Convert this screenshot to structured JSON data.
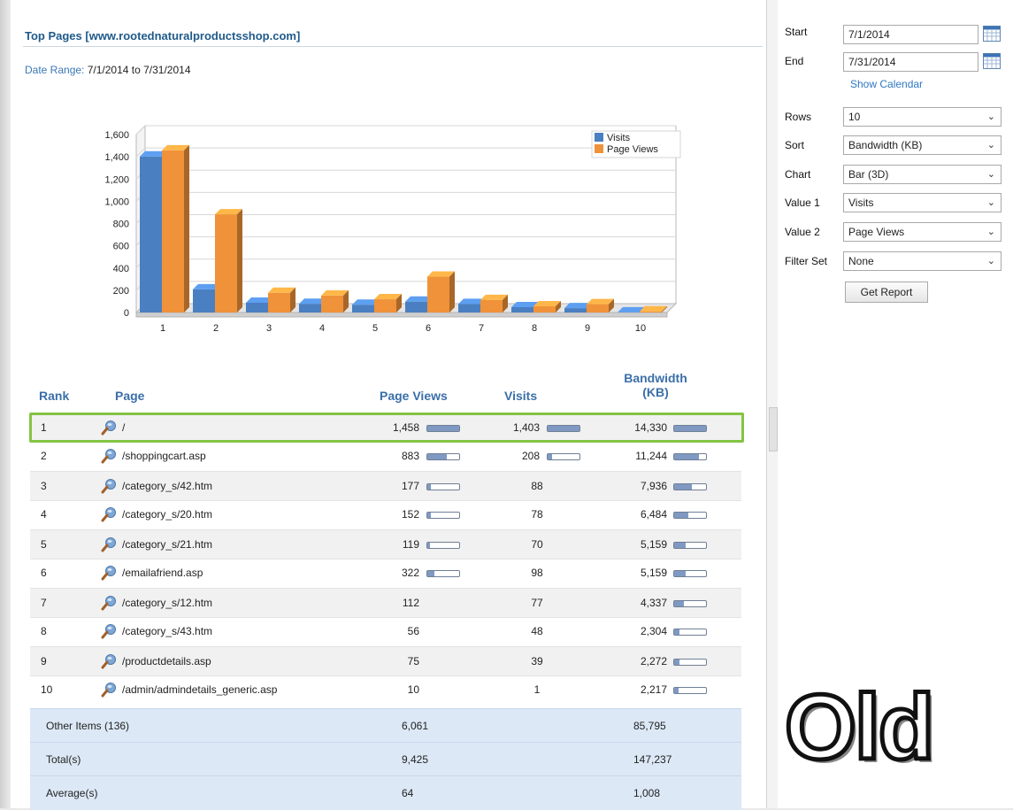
{
  "report": {
    "title": "Top Pages [www.rootednaturalproductsshop.com]",
    "date_range_label": "Date Range:",
    "date_range_value": "7/1/2014 to 7/31/2014"
  },
  "chart_data": {
    "type": "bar",
    "categories": [
      "1",
      "2",
      "3",
      "4",
      "5",
      "6",
      "7",
      "8",
      "9",
      "10"
    ],
    "series": [
      {
        "name": "Visits",
        "color": "#4a7fc1",
        "values": [
          1403,
          208,
          88,
          78,
          70,
          98,
          77,
          48,
          39,
          1
        ]
      },
      {
        "name": "Page Views",
        "color": "#f0923a",
        "values": [
          1458,
          883,
          177,
          152,
          119,
          322,
          112,
          56,
          75,
          10
        ]
      }
    ],
    "yticks": [
      "1,600",
      "1,400",
      "1,200",
      "1,000",
      "800",
      "600",
      "400",
      "200",
      "0"
    ],
    "ylim": [
      0,
      1600
    ],
    "legend": "top-right",
    "style": "3d"
  },
  "table": {
    "headers": {
      "rank": "Rank",
      "page": "Page",
      "page_views": "Page Views",
      "visits": "Visits",
      "bandwidth_1": "Bandwidth",
      "bandwidth_2": "(KB)"
    },
    "rows": [
      {
        "rank": "1",
        "page": "/",
        "pv": "1,458",
        "pv_frac": 1.0,
        "visits": "1,403",
        "v_frac": 1.0,
        "bw": "14,330",
        "bw_frac": 1.0
      },
      {
        "rank": "2",
        "page": "/shoppingcart.asp",
        "pv": "883",
        "pv_frac": 0.61,
        "visits": "208",
        "v_frac": 0.15,
        "bw": "11,244",
        "bw_frac": 0.78
      },
      {
        "rank": "3",
        "page": "/category_s/42.htm",
        "pv": "177",
        "pv_frac": 0.12,
        "visits": "88",
        "v_frac": null,
        "bw": "7,936",
        "bw_frac": 0.55
      },
      {
        "rank": "4",
        "page": "/category_s/20.htm",
        "pv": "152",
        "pv_frac": 0.1,
        "visits": "78",
        "v_frac": null,
        "bw": "6,484",
        "bw_frac": 0.45
      },
      {
        "rank": "5",
        "page": "/category_s/21.htm",
        "pv": "119",
        "pv_frac": 0.08,
        "visits": "70",
        "v_frac": null,
        "bw": "5,159",
        "bw_frac": 0.36
      },
      {
        "rank": "6",
        "page": "/emailafriend.asp",
        "pv": "322",
        "pv_frac": 0.22,
        "visits": "98",
        "v_frac": null,
        "bw": "5,159",
        "bw_frac": 0.36
      },
      {
        "rank": "7",
        "page": "/category_s/12.htm",
        "pv": "112",
        "pv_frac": null,
        "visits": "77",
        "v_frac": null,
        "bw": "4,337",
        "bw_frac": 0.3
      },
      {
        "rank": "8",
        "page": "/category_s/43.htm",
        "pv": "56",
        "pv_frac": null,
        "visits": "48",
        "v_frac": null,
        "bw": "2,304",
        "bw_frac": 0.16
      },
      {
        "rank": "9",
        "page": "/productdetails.asp",
        "pv": "75",
        "pv_frac": null,
        "visits": "39",
        "v_frac": null,
        "bw": "2,272",
        "bw_frac": 0.16
      },
      {
        "rank": "10",
        "page": "/admin/admindetails_generic.asp",
        "pv": "10",
        "pv_frac": null,
        "visits": "1",
        "v_frac": null,
        "bw": "2,217",
        "bw_frac": 0.15
      }
    ],
    "summary": [
      {
        "label": "Other Items (136)",
        "pv": "6,061",
        "bw": "85,795"
      },
      {
        "label": "Total(s)",
        "pv": "9,425",
        "bw": "147,237"
      },
      {
        "label": "Average(s)",
        "pv": "64",
        "bw": "1,008"
      }
    ],
    "highlight_color": "#84c443"
  },
  "sidebar": {
    "start_label": "Start",
    "start_value": "7/1/2014",
    "end_label": "End",
    "end_value": "7/31/2014",
    "show_calendar": "Show Calendar",
    "rows_label": "Rows",
    "rows_value": "10",
    "sort_label": "Sort",
    "sort_value": "Bandwidth (KB)",
    "chart_label": "Chart",
    "chart_value": "Bar (3D)",
    "value1_label": "Value 1",
    "value1_value": "Visits",
    "value2_label": "Value 2",
    "value2_value": "Page Views",
    "filter_label": "Filter Set",
    "filter_value": "None",
    "get_report": "Get Report"
  },
  "overlay": {
    "text": "Old"
  }
}
